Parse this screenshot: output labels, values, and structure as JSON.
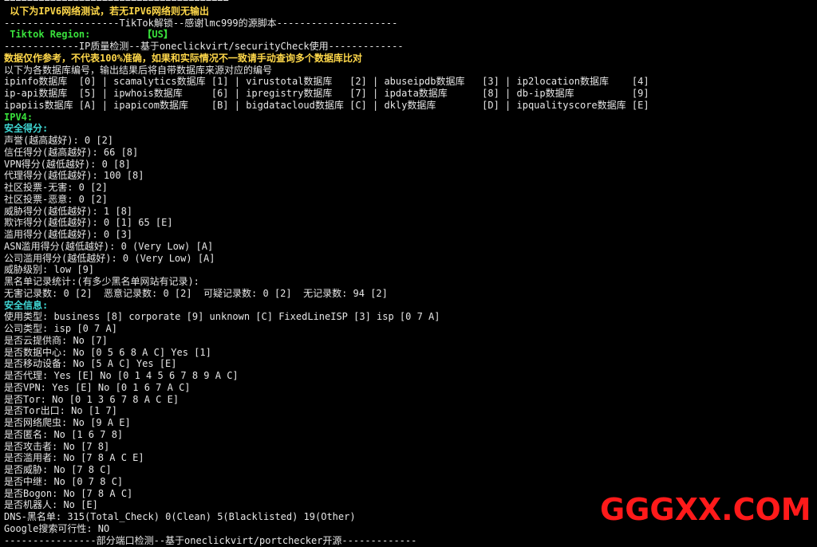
{
  "terminal": {
    "lines": [
      {
        "text": "=======================================",
        "color": "white"
      },
      {
        "text": " 以下为IPV6网络测试，若无IPV6网络则无输出",
        "color": "yellow"
      },
      {
        "text": "--------------------TikTok解锁--感谢lmc999的源脚本---------------------",
        "color": "white"
      },
      {
        "text": " Tiktok Region:         【US】",
        "color": "green"
      },
      {
        "text": "-------------IP质量检测--基于oneclickvirt/securityCheck使用-------------",
        "color": "white"
      },
      {
        "text": "数据仅作参考，不代表100%准确，如果和实际情况不一致请手动查询多个数据库比对",
        "color": "yellow"
      },
      {
        "text": "以下为各数据库编号，输出结果后将自带数据库来源对应的编号",
        "color": "white"
      },
      {
        "text": "ipinfo数据库  [0] | scamalytics数据库 [1] | virustotal数据库   [2] | abuseipdb数据库   [3] | ip2location数据库    [4]",
        "color": "white"
      },
      {
        "text": "ip-api数据库  [5] | ipwhois数据库     [6] | ipregistry数据库   [7] | ipdata数据库      [8] | db-ip数据库          [9]",
        "color": "white"
      },
      {
        "text": "ipapiis数据库 [A] | ipapicom数据库    [B] | bigdatacloud数据库 [C] | dkly数据库        [D] | ipqualityscore数据库 [E]",
        "color": "white"
      },
      {
        "text": "IPV4:",
        "color": "green"
      },
      {
        "text": "安全得分:",
        "color": "cyan"
      },
      {
        "text": "声誉(越高越好): 0 [2]",
        "color": "white"
      },
      {
        "text": "信任得分(越高越好): 66 [8]",
        "color": "white"
      },
      {
        "text": "VPN得分(越低越好): 0 [8]",
        "color": "white"
      },
      {
        "text": "代理得分(越低越好): 100 [8]",
        "color": "white"
      },
      {
        "text": "社区投票-无害: 0 [2]",
        "color": "white"
      },
      {
        "text": "社区投票-恶意: 0 [2]",
        "color": "white"
      },
      {
        "text": "威胁得分(越低越好): 1 [8]",
        "color": "white"
      },
      {
        "text": "欺诈得分(越低越好): 0 [1] 65 [E]",
        "color": "white"
      },
      {
        "text": "滥用得分(越低越好): 0 [3]",
        "color": "white"
      },
      {
        "text": "ASN滥用得分(越低越好): 0 (Very Low) [A]",
        "color": "white"
      },
      {
        "text": "公司滥用得分(越低越好): 0 (Very Low) [A]",
        "color": "white"
      },
      {
        "text": "威胁级别: low [9]",
        "color": "white"
      },
      {
        "text": "黑名单记录统计:(有多少黑名单网站有记录):",
        "color": "white"
      },
      {
        "text": "无害记录数: 0 [2]  恶意记录数: 0 [2]  可疑记录数: 0 [2]  无记录数: 94 [2]",
        "color": "white"
      },
      {
        "text": "安全信息:",
        "color": "cyan"
      },
      {
        "text": "使用类型: business [8] corporate [9] unknown [C] FixedLineISP [3] isp [0 7 A]",
        "color": "white"
      },
      {
        "text": "公司类型: isp [0 7 A]",
        "color": "white"
      },
      {
        "text": "是否云提供商: No [7]",
        "color": "white"
      },
      {
        "text": "是否数据中心: No [0 5 6 8 A C] Yes [1]",
        "color": "white"
      },
      {
        "text": "是否移动设备: No [5 A C] Yes [E]",
        "color": "white"
      },
      {
        "text": "是否代理: Yes [E] No [0 1 4 5 6 7 8 9 A C]",
        "color": "white"
      },
      {
        "text": "是否VPN: Yes [E] No [0 1 6 7 A C]",
        "color": "white"
      },
      {
        "text": "是否Tor: No [0 1 3 6 7 8 A C E]",
        "color": "white"
      },
      {
        "text": "是否Tor出口: No [1 7]",
        "color": "white"
      },
      {
        "text": "是否网络爬虫: No [9 A E]",
        "color": "white"
      },
      {
        "text": "是否匿名: No [1 6 7 8]",
        "color": "white"
      },
      {
        "text": "是否攻击者: No [7 8]",
        "color": "white"
      },
      {
        "text": "是否滥用者: No [7 8 A C E]",
        "color": "white"
      },
      {
        "text": "是否威胁: No [7 8 C]",
        "color": "white"
      },
      {
        "text": "是否中继: No [0 7 8 C]",
        "color": "white"
      },
      {
        "text": "是否Bogon: No [7 8 A C]",
        "color": "white"
      },
      {
        "text": "是否机器人: No [E]",
        "color": "white"
      },
      {
        "text": "DNS-黑名单: 315(Total_Check) 0(Clean) 5(Blacklisted) 19(Other)",
        "color": "white"
      },
      {
        "text": "Google搜索可行性: NO",
        "color": "white"
      },
      {
        "text": "----------------部分端口检测--基于oneclickvirt/portchecker开源-------------",
        "color": "white"
      }
    ]
  },
  "watermark": {
    "text": "GGGXX.COM",
    "color": "#ff1a1a"
  },
  "colors": {
    "background": "#000000",
    "white": "#e6e6e6",
    "yellow": "#ffd84a",
    "green": "#39e13c",
    "cyan": "#3fd6d3"
  }
}
